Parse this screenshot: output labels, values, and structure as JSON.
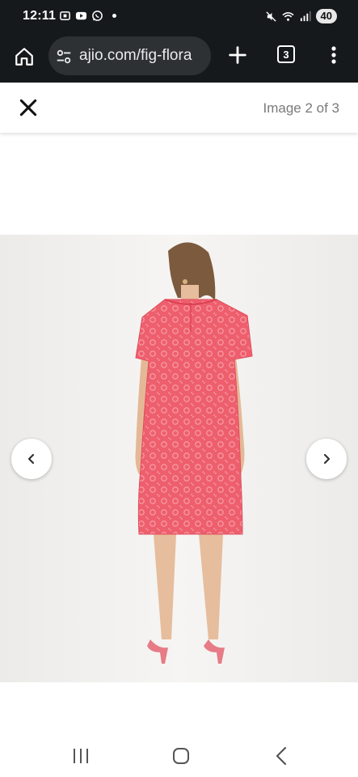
{
  "status_bar": {
    "time": "12:11",
    "battery": "40"
  },
  "browser": {
    "url": "ajio.com/fig-flora",
    "tab_count": "3"
  },
  "viewer": {
    "counter": "Image 2 of 3"
  },
  "product_image": {
    "description_icon": "product-photo",
    "dress_color": "#ee5f6e",
    "background_color": "#f1f0ee"
  },
  "icons": {
    "home": "home-icon",
    "site_settings": "tune-icon",
    "new_tab": "plus-icon",
    "menu": "more-vert-icon",
    "close": "close-icon",
    "prev": "chevron-left-icon",
    "next": "chevron-right-icon"
  }
}
